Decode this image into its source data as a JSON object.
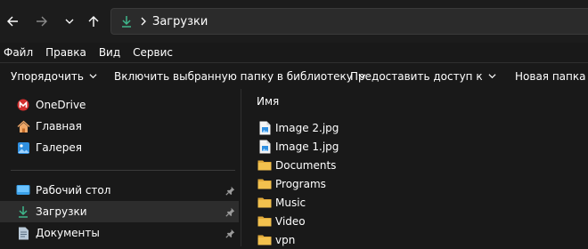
{
  "address": {
    "folder": "Загрузки"
  },
  "menu": [
    "Файл",
    "Правка",
    "Вид",
    "Сервис"
  ],
  "toolbar": {
    "organize": "Упорядочить",
    "include_library": "Включить выбранную папку в библиотеку",
    "share": "Предоставить доступ к",
    "new_folder": "Новая папка"
  },
  "sidebar": {
    "items": [
      {
        "label": "OneDrive",
        "icon": "onedrive-icon"
      },
      {
        "label": "Главная",
        "icon": "home-icon"
      },
      {
        "label": "Галерея",
        "icon": "gallery-icon"
      },
      {
        "label": "Рабочий стол",
        "icon": "desktop-icon",
        "pinned": true
      },
      {
        "label": "Загрузки",
        "icon": "downloads-icon",
        "pinned": true,
        "selected": true
      },
      {
        "label": "Документы",
        "icon": "documents-icon",
        "pinned": true
      }
    ]
  },
  "filelist": {
    "column_name": "Имя",
    "files": [
      {
        "name": "Image 2.jpg",
        "type": "image"
      },
      {
        "name": "Image 1.jpg",
        "type": "image"
      },
      {
        "name": "Documents",
        "type": "folder"
      },
      {
        "name": "Programs",
        "type": "folder"
      },
      {
        "name": "Music",
        "type": "folder"
      },
      {
        "name": "Video",
        "type": "folder"
      },
      {
        "name": "vpn",
        "type": "folder"
      }
    ]
  },
  "colors": {
    "accent": "#3fb68b",
    "folder": "#f2c14e",
    "background": "#191919",
    "selected": "#2d2d2d"
  }
}
